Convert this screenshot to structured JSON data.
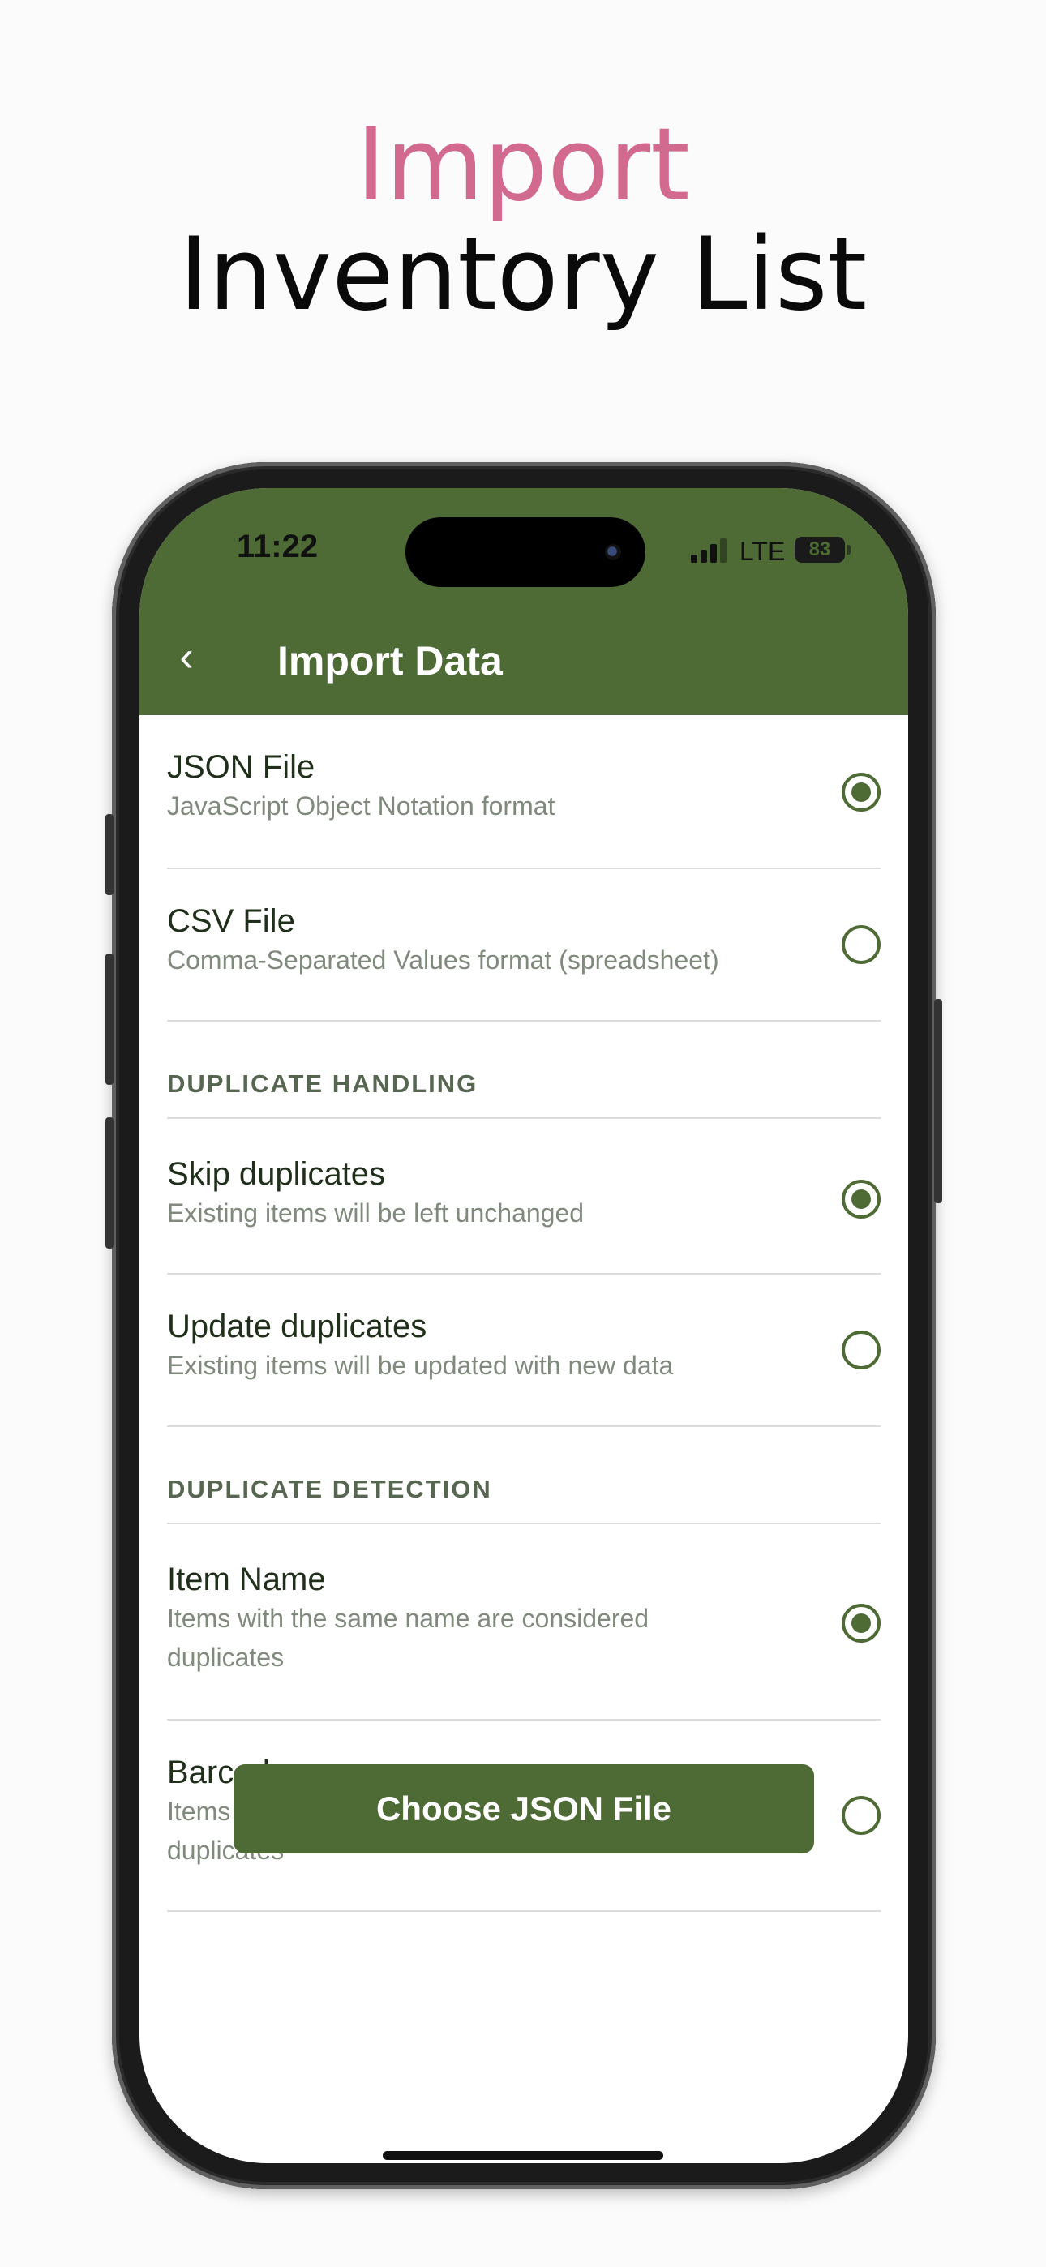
{
  "headline": {
    "line1": "Import",
    "line2": "Inventory List"
  },
  "status_bar": {
    "time": "11:22",
    "network": "LTE",
    "battery": "83"
  },
  "nav": {
    "back_glyph": "‹",
    "title": "Import Data"
  },
  "file_format": {
    "options": [
      {
        "title": "JSON File",
        "subtitle": "JavaScript Object Notation format",
        "selected": true
      },
      {
        "title": "CSV File",
        "subtitle": "Comma-Separated Values format (spreadsheet)",
        "selected": false
      }
    ]
  },
  "duplicate_handling": {
    "header": "DUPLICATE HANDLING",
    "options": [
      {
        "title": "Skip duplicates",
        "subtitle": "Existing items will be left unchanged",
        "selected": true
      },
      {
        "title": "Update duplicates",
        "subtitle": "Existing items will be updated with new data",
        "selected": false
      }
    ]
  },
  "duplicate_detection": {
    "header": "DUPLICATE DETECTION",
    "options": [
      {
        "title": "Item Name",
        "subtitle": "Items with the same name are considered duplicates",
        "selected": true
      },
      {
        "title": "Barcode",
        "subtitle": "Items with the same barcode are considered duplicates",
        "selected": false
      }
    ]
  },
  "action": {
    "label": "Choose JSON File"
  },
  "colors": {
    "accent": "#4e6a35",
    "headline_pink": "#d2698f",
    "subtitle_gray": "#7f8a7c"
  }
}
